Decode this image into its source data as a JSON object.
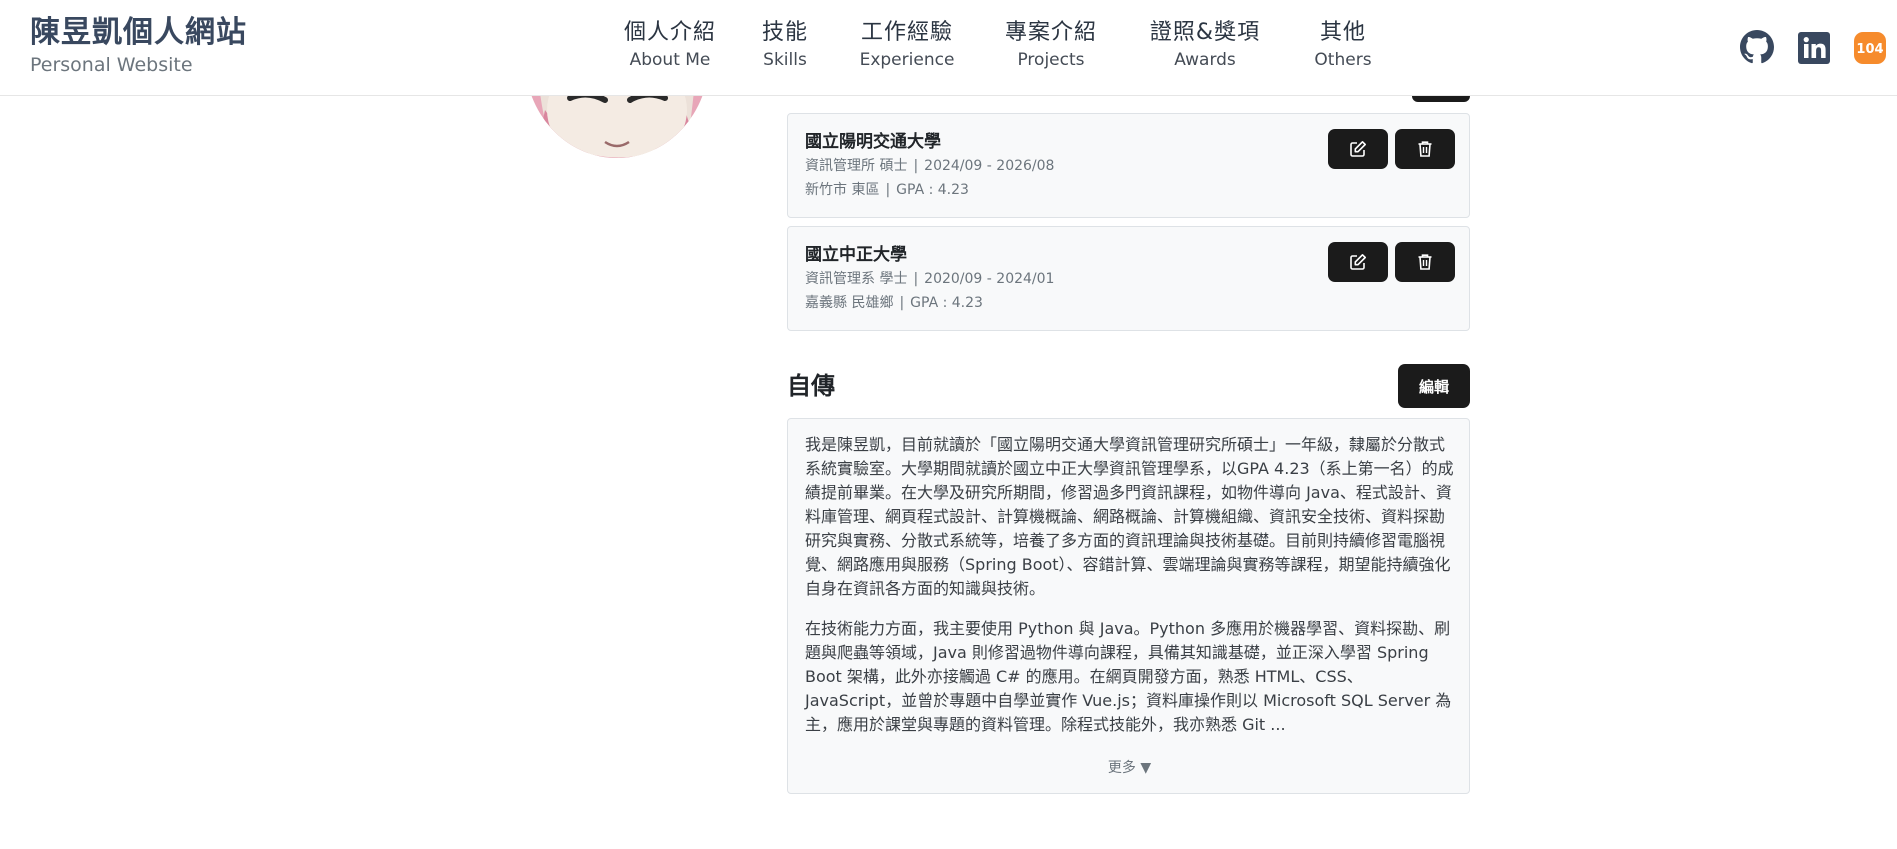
{
  "header": {
    "brand_title": "陳昱凱個人網站",
    "brand_subtitle": "Personal Website",
    "nav": [
      {
        "zh": "個人介紹",
        "en": "About Me"
      },
      {
        "zh": "技能",
        "en": "Skills"
      },
      {
        "zh": "工作經驗",
        "en": "Experience"
      },
      {
        "zh": "專案介紹",
        "en": "Projects"
      },
      {
        "zh": "證照&獎項",
        "en": "Awards"
      },
      {
        "zh": "其他",
        "en": "Others"
      }
    ],
    "social": {
      "badge_104": "104"
    }
  },
  "education": [
    {
      "school": "國立陽明交通大學",
      "dept_degree": "資訊管理所 碩士",
      "period": "2024/09 - 2026/08",
      "location": "新竹市 東區",
      "gpa": "GPA : 4.23"
    },
    {
      "school": "國立中正大學",
      "dept_degree": "資訊管理系 學士",
      "period": "2020/09 - 2024/01",
      "location": "嘉義縣 民雄鄉",
      "gpa": "GPA : 4.23"
    }
  ],
  "autobiography": {
    "title": "自傳",
    "edit_label": "編輯",
    "paragraph1": "我是陳昱凱，目前就讀於「國立陽明交通大學資訊管理研究所碩士」一年級，隸屬於分散式系統實驗室。大學期間就讀於國立中正大學資訊管理學系，以GPA 4.23（系上第一名）的成績提前畢業。在大學及研究所期間，修習過多門資訊課程，如物件導向 Java、程式設計、資料庫管理、網頁程式設計、計算機概論、網路概論、計算機組織、資訊安全技術、資料探勘研究與實務、分散式系統等，培養了多方面的資訊理論與技術基礎。目前則持續修習電腦視覺、網路應用與服務（Spring Boot）、容錯計算、雲端理論與實務等課程，期望能持續強化自身在資訊各方面的知識與技術。",
    "paragraph2": "在技術能力方面，我主要使用 Python 與 Java。Python 多應用於機器學習、資料探勘、刷題與爬蟲等領域，Java 則修習過物件導向課程，具備其知識基礎，並正深入學習 Spring Boot 架構，此外亦接觸過 C# 的應用。在網頁開發方面，熟悉 HTML、CSS、JavaScript，並曾於專題中自學並實作 Vue.js；資料庫操作則以 Microsoft SQL Server 為主，應用於課堂與專題的資料管理。除程式技能外，我亦熟悉 Git ...",
    "more_label": "更多 ▼"
  },
  "colors": {
    "button_dark": "#1b1b1b",
    "card_bg": "#f8f9fa",
    "brand_text": "#39485f",
    "badge_104": "#f68b2c"
  }
}
